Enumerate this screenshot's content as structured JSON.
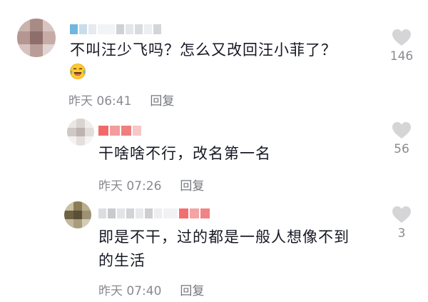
{
  "comments": [
    {
      "text": "不叫汪少飞吗？怎么又改回汪小菲了？",
      "emoji": "face-with-tears-of-joy",
      "time": "昨天 06:41",
      "reply_label": "回复",
      "likes": "146"
    },
    {
      "text": "干啥啥不行，改名第一名",
      "time": "昨天 07:26",
      "reply_label": "回复",
      "likes": "56"
    },
    {
      "text_line1": "即是不干，过的都是一般人想像不到",
      "text_line2": "的生活",
      "time": "昨天 07:40",
      "reply_label": "回复",
      "likes": "3"
    }
  ],
  "colors": {
    "heart": "#d5d5d8",
    "meta_text": "#888a90",
    "body_text": "#161823"
  }
}
